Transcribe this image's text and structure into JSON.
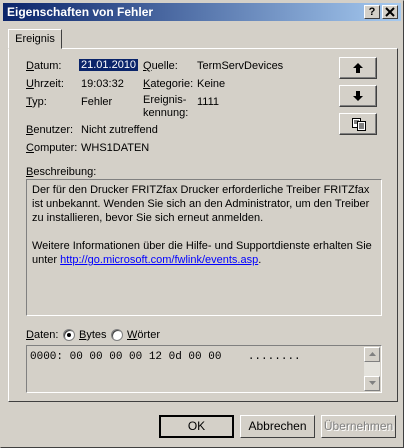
{
  "window": {
    "title": "Eigenschaften von Fehler",
    "help_button": "?",
    "close_button": "X"
  },
  "tab": {
    "label": "Ereignis"
  },
  "fields": {
    "datum_label": "Datum:",
    "datum_value": "21.01.2010",
    "uhrzeit_label": "Uhrzeit:",
    "uhrzeit_value": "19:03:32",
    "typ_label": "Typ:",
    "typ_value": "Fehler",
    "benutzer_label": "Benutzer:",
    "benutzer_value": "Nicht zutreffend",
    "computer_label": "Computer:",
    "computer_value": "WHS1DATEN",
    "quelle_label": "Quelle:",
    "quelle_value": "TermServDevices",
    "kategorie_label": "Kategorie:",
    "kategorie_value": "Keine",
    "ereignis_label_1": "Ereignis-",
    "ereignis_label_2": "kennung:",
    "ereignis_value": "1111"
  },
  "side_buttons": {
    "up_icon": "arrow-up-icon",
    "down_icon": "arrow-down-icon",
    "copy_icon": "copy-icon"
  },
  "description": {
    "label": "Beschreibung:",
    "para1": "Der für den Drucker FRITZfax Drucker erforderliche Treiber FRITZfax ist unbekannt. Wenden Sie sich an den Administrator, um den Treiber zu installieren, bevor Sie sich erneut anmelden.",
    "para2_prefix": "Weitere Informationen über die Hilfe- und Supportdienste erhalten Sie unter ",
    "link": "http://go.microsoft.com/fwlink/events.asp",
    "para2_suffix": "."
  },
  "data_section": {
    "label": "Daten:",
    "option_bytes": "Bytes",
    "option_words": "Wörter",
    "selected": "Bytes",
    "hex_line": "0000: 00 00 00 00 12 0d 00 00    ........"
  },
  "buttons": {
    "ok": "OK",
    "cancel": "Abbrechen",
    "apply": "Übernehmen"
  }
}
